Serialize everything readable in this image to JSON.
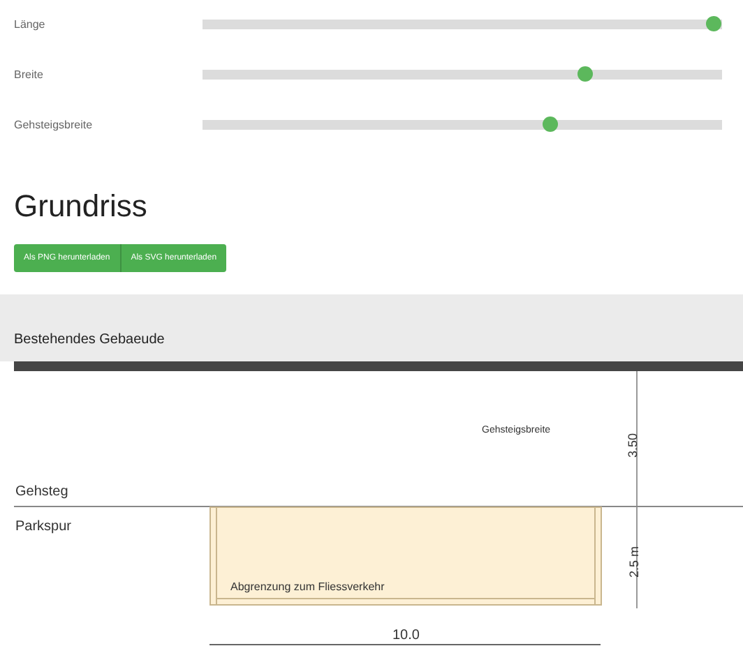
{
  "sliders": [
    {
      "label": "Länge",
      "level": 1.0
    },
    {
      "label": "Breite",
      "level": 0.745
    },
    {
      "label": "Gehsteigsbreite",
      "level": 0.675
    }
  ],
  "heading": "Grundriss",
  "buttons": [
    "Als PNG herunterladen",
    "Als SVG herunterladen"
  ],
  "plan": {
    "building_label": "Bestehendes Gebaeude",
    "sidewalk_width_label": "Gehsteigsbreite",
    "sidewalk_dimension": "3.50",
    "sidewalk_label": "Gehsteg",
    "parking_label": "Parkspur",
    "boundary_label": "Abgrenzung zum Fliessverkehr",
    "parking_depth": "2.5 m",
    "parking_length": "10.0"
  }
}
